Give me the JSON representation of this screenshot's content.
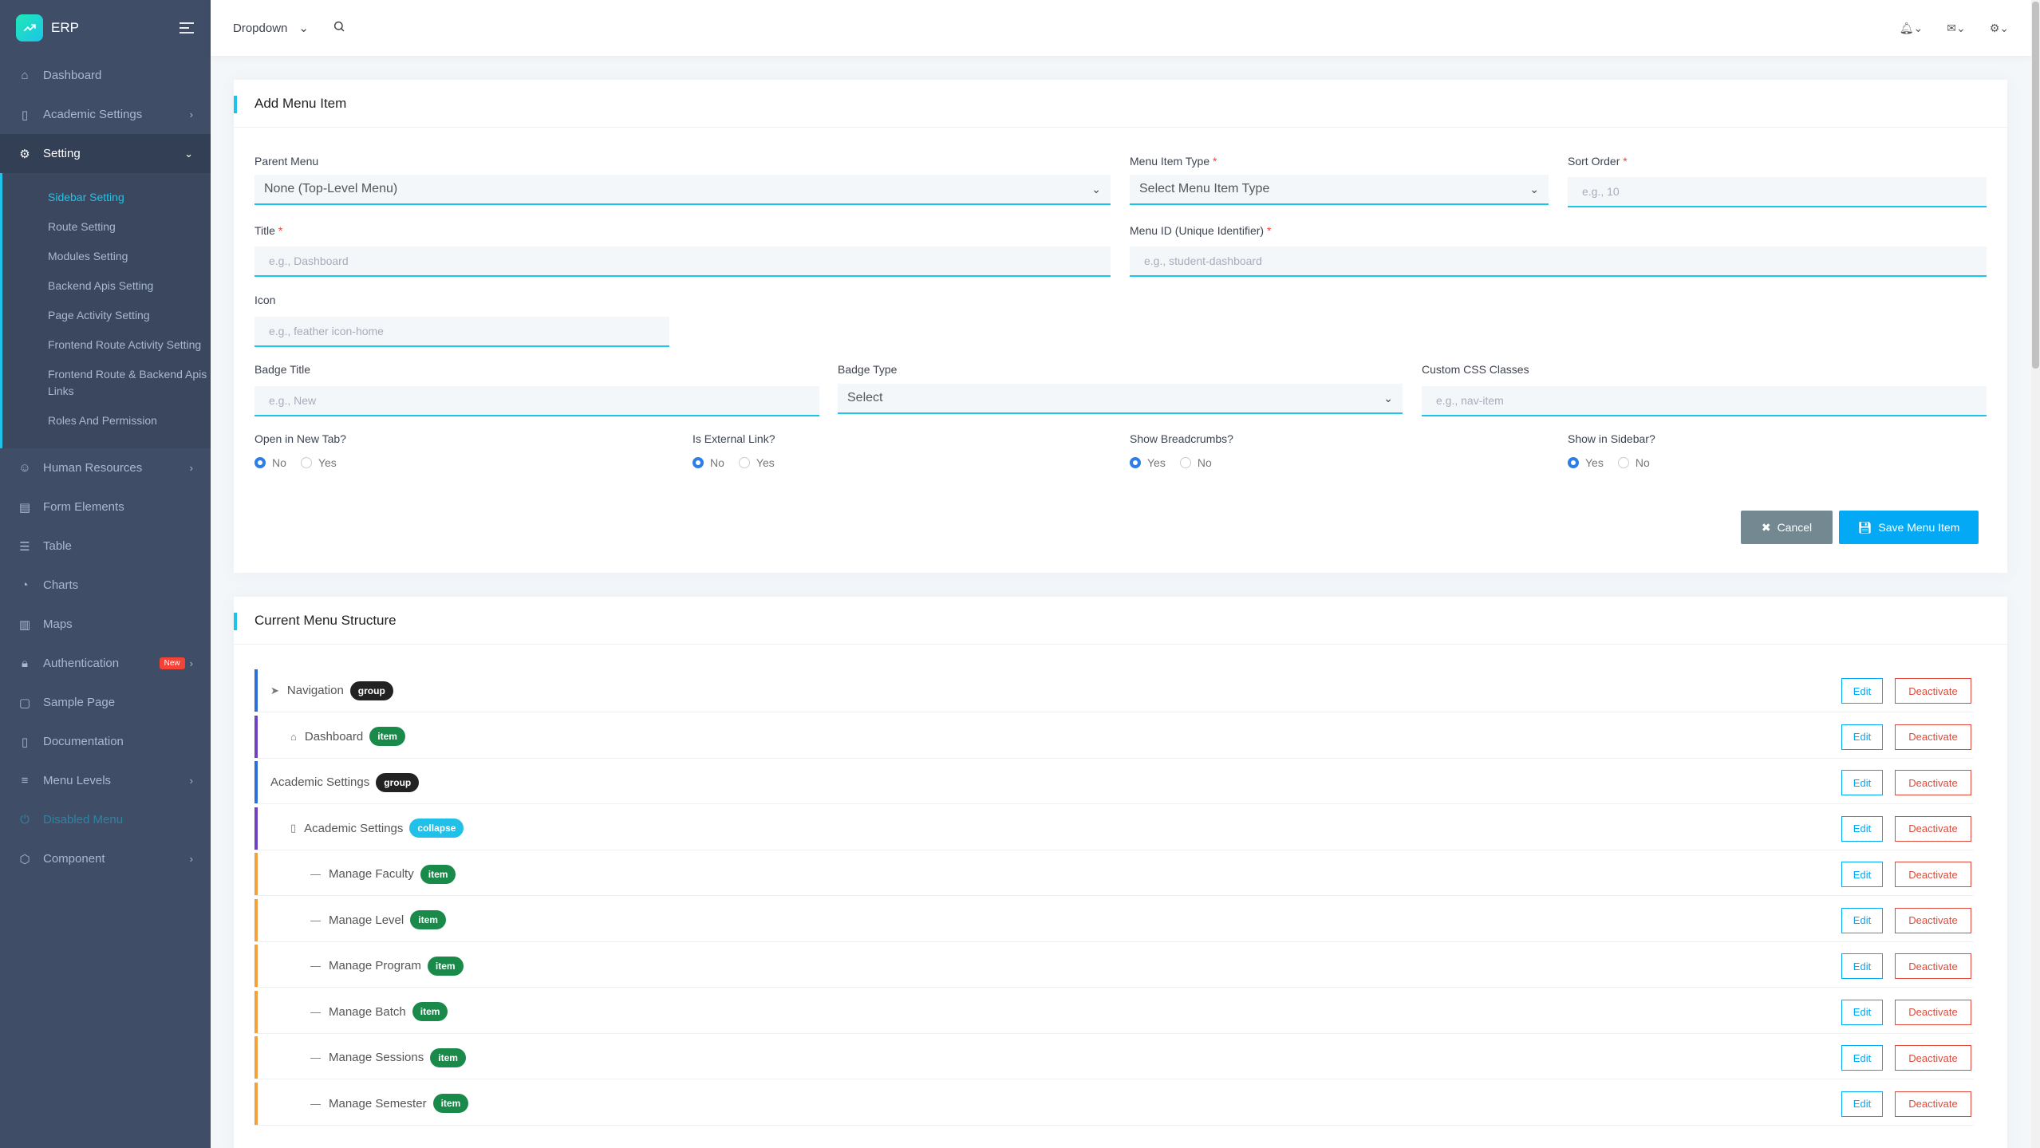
{
  "sidebar": {
    "brand": "ERP",
    "items": [
      {
        "label": "Dashboard"
      },
      {
        "label": "Academic Settings"
      },
      {
        "label": "Setting"
      },
      {
        "label": "Human Resources"
      },
      {
        "label": "Form Elements"
      },
      {
        "label": "Table"
      },
      {
        "label": "Charts"
      },
      {
        "label": "Maps"
      },
      {
        "label": "Authentication",
        "badge": "New"
      },
      {
        "label": "Sample Page"
      },
      {
        "label": "Documentation"
      },
      {
        "label": "Menu Levels"
      },
      {
        "label": "Disabled Menu"
      },
      {
        "label": "Component"
      }
    ],
    "submenu": [
      "Sidebar Setting",
      "Route Setting",
      "Modules Setting",
      "Backend Apis Setting",
      "Page Activity Setting",
      "Frontend Route Activity Setting",
      "Frontend Route & Backend Apis Links",
      "Roles And Permission"
    ]
  },
  "header": {
    "dropdown": "Dropdown"
  },
  "form": {
    "title": "Add Menu Item",
    "parent_menu": {
      "label": "Parent Menu",
      "value": "None (Top-Level Menu)"
    },
    "menu_item_type": {
      "label": "Menu Item Type",
      "value": "Select Menu Item Type"
    },
    "sort_order": {
      "label": "Sort Order",
      "placeholder": "e.g., 10"
    },
    "title_field": {
      "label": "Title",
      "placeholder": "e.g., Dashboard"
    },
    "menu_id": {
      "label": "Menu ID (Unique Identifier)",
      "placeholder": "e.g., student-dashboard"
    },
    "icon": {
      "label": "Icon",
      "placeholder": "e.g., feather icon-home"
    },
    "badge_title": {
      "label": "Badge Title",
      "placeholder": "e.g., New"
    },
    "badge_type": {
      "label": "Badge Type",
      "value": "Select"
    },
    "css_classes": {
      "label": "Custom CSS Classes",
      "placeholder": "e.g., nav-item"
    },
    "open_new_tab": {
      "label": "Open in New Tab?",
      "options": [
        "No",
        "Yes"
      ],
      "selected": "No"
    },
    "external_link": {
      "label": "Is External Link?",
      "options": [
        "No",
        "Yes"
      ],
      "selected": "No"
    },
    "breadcrumbs": {
      "label": "Show Breadcrumbs?",
      "options": [
        "Yes",
        "No"
      ],
      "selected": "Yes"
    },
    "in_sidebar": {
      "label": "Show in Sidebar?",
      "options": [
        "Yes",
        "No"
      ],
      "selected": "Yes"
    },
    "cancel": "Cancel",
    "save": "Save Menu Item"
  },
  "structure": {
    "title": "Current Menu Structure",
    "edit_label": "Edit",
    "deactivate_label": "Deactivate",
    "rows": [
      {
        "title": "Navigation",
        "type": "group",
        "color": "#2d6fd6",
        "level": 0,
        "icon": "navigation-arrow-icon"
      },
      {
        "title": "Dashboard",
        "type": "item",
        "color": "#6f42c1",
        "level": 1,
        "icon": "home-icon"
      },
      {
        "title": "Academic Settings",
        "type": "group",
        "color": "#2d6fd6",
        "level": 0,
        "icon": ""
      },
      {
        "title": "Academic Settings",
        "type": "collapse",
        "color": "#6f42c1",
        "level": 1,
        "icon": "book-icon"
      },
      {
        "title": "Manage Faculty",
        "type": "item",
        "color": "#f0a03c",
        "level": 2,
        "icon": "dash-icon"
      },
      {
        "title": "Manage Level",
        "type": "item",
        "color": "#f0a03c",
        "level": 2,
        "icon": "dash-icon"
      },
      {
        "title": "Manage Program",
        "type": "item",
        "color": "#f0a03c",
        "level": 2,
        "icon": "dash-icon"
      },
      {
        "title": "Manage Batch",
        "type": "item",
        "color": "#f0a03c",
        "level": 2,
        "icon": "dash-icon"
      },
      {
        "title": "Manage Sessions",
        "type": "item",
        "color": "#f0a03c",
        "level": 2,
        "icon": "dash-icon"
      },
      {
        "title": "Manage Semester",
        "type": "item",
        "color": "#f0a03c",
        "level": 2,
        "icon": "dash-icon"
      }
    ]
  }
}
